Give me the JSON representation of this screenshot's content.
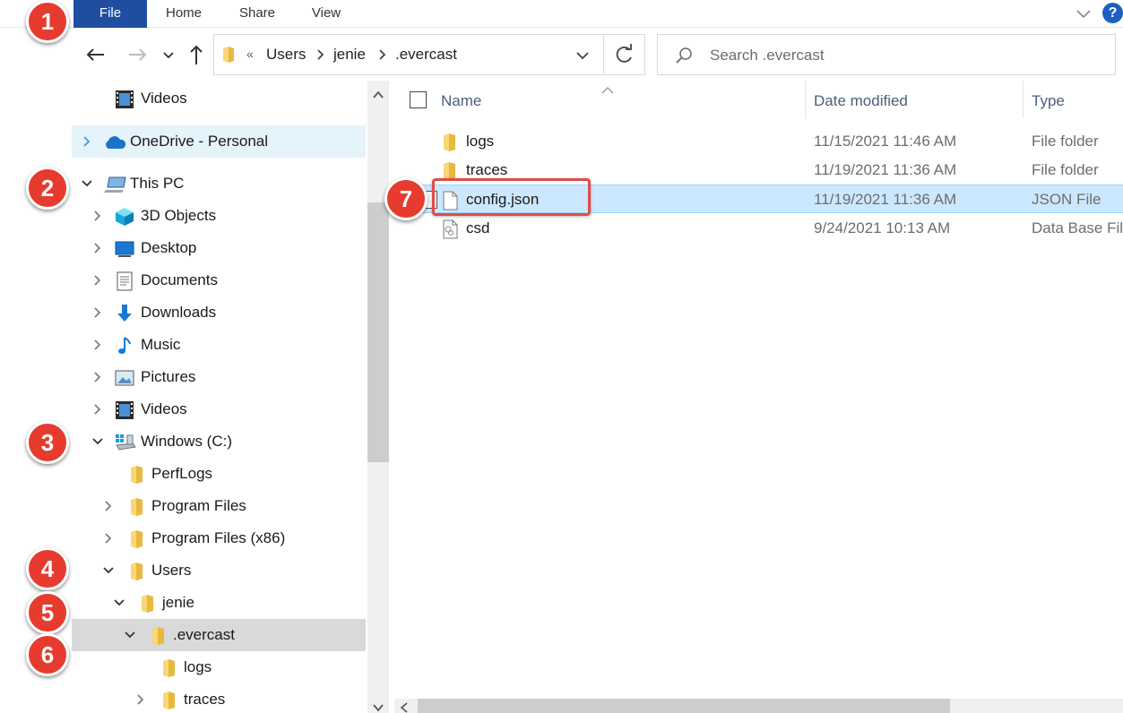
{
  "ribbon": {
    "tabs": [
      "File",
      "Home",
      "Share",
      "View"
    ],
    "help": "?"
  },
  "address": {
    "more": "«",
    "crumbs": [
      "Users",
      "jenie",
      ".evercast"
    ]
  },
  "search": {
    "placeholder": "Search .evercast"
  },
  "nav": {
    "items": [
      {
        "label": "Videos",
        "icon": "video-icon",
        "expanded": null
      },
      {
        "label": "OneDrive - Personal",
        "icon": "onedrive-cloud-icon",
        "expanded": false
      },
      {
        "label": "This PC",
        "icon": "computer-icon",
        "expanded": true
      },
      {
        "label": "3D Objects",
        "icon": "3d-objects-icon",
        "expanded": false
      },
      {
        "label": "Desktop",
        "icon": "desktop-icon",
        "expanded": false
      },
      {
        "label": "Documents",
        "icon": "documents-icon",
        "expanded": false
      },
      {
        "label": "Downloads",
        "icon": "downloads-icon",
        "expanded": false
      },
      {
        "label": "Music",
        "icon": "music-icon",
        "expanded": false
      },
      {
        "label": "Pictures",
        "icon": "pictures-icon",
        "expanded": false
      },
      {
        "label": "Videos",
        "icon": "video-icon",
        "expanded": false
      },
      {
        "label": "Windows (C:)",
        "icon": "drive-icon",
        "expanded": true
      },
      {
        "label": "PerfLogs",
        "icon": "folder-icon",
        "expanded": null
      },
      {
        "label": "Program Files",
        "icon": "folder-icon",
        "expanded": false
      },
      {
        "label": "Program Files (x86)",
        "icon": "folder-icon",
        "expanded": false
      },
      {
        "label": "Users",
        "icon": "folder-icon",
        "expanded": true
      },
      {
        "label": "jenie",
        "icon": "folder-icon",
        "expanded": true
      },
      {
        "label": ".evercast",
        "icon": "folder-icon",
        "expanded": true
      },
      {
        "label": "logs",
        "icon": "folder-icon",
        "expanded": null
      },
      {
        "label": "traces",
        "icon": "folder-icon",
        "expanded": false
      }
    ]
  },
  "columns": {
    "name": "Name",
    "date": "Date modified",
    "type": "Type"
  },
  "files": [
    {
      "name": "logs",
      "date": "11/15/2021 11:46 AM",
      "type": "File folder",
      "icon": "folder-icon"
    },
    {
      "name": "traces",
      "date": "11/19/2021 11:36 AM",
      "type": "File folder",
      "icon": "folder-icon"
    },
    {
      "name": "config.json",
      "date": "11/19/2021 11:36 AM",
      "type": "JSON File",
      "icon": "file-icon"
    },
    {
      "name": "csd",
      "date": "9/24/2021 10:13 AM",
      "type": "Data Base File",
      "icon": "database-file-icon"
    }
  ],
  "annotations": [
    "1",
    "2",
    "3",
    "4",
    "5",
    "6",
    "7"
  ],
  "colors": {
    "accent": "#1f4ea1",
    "selection": "#cce8ff",
    "badge": "#e63b2e",
    "folder": "#f8d775"
  }
}
